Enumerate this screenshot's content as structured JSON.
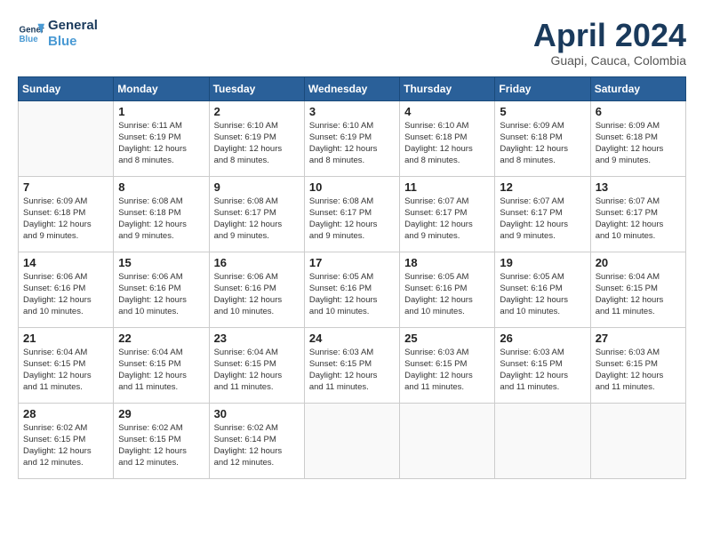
{
  "header": {
    "logo_line1": "General",
    "logo_line2": "Blue",
    "month_year": "April 2024",
    "location": "Guapi, Cauca, Colombia"
  },
  "weekdays": [
    "Sunday",
    "Monday",
    "Tuesday",
    "Wednesday",
    "Thursday",
    "Friday",
    "Saturday"
  ],
  "weeks": [
    [
      {
        "day": null,
        "info": null
      },
      {
        "day": "1",
        "info": "Sunrise: 6:11 AM\nSunset: 6:19 PM\nDaylight: 12 hours\nand 8 minutes."
      },
      {
        "day": "2",
        "info": "Sunrise: 6:10 AM\nSunset: 6:19 PM\nDaylight: 12 hours\nand 8 minutes."
      },
      {
        "day": "3",
        "info": "Sunrise: 6:10 AM\nSunset: 6:19 PM\nDaylight: 12 hours\nand 8 minutes."
      },
      {
        "day": "4",
        "info": "Sunrise: 6:10 AM\nSunset: 6:18 PM\nDaylight: 12 hours\nand 8 minutes."
      },
      {
        "day": "5",
        "info": "Sunrise: 6:09 AM\nSunset: 6:18 PM\nDaylight: 12 hours\nand 8 minutes."
      },
      {
        "day": "6",
        "info": "Sunrise: 6:09 AM\nSunset: 6:18 PM\nDaylight: 12 hours\nand 9 minutes."
      }
    ],
    [
      {
        "day": "7",
        "info": "Sunrise: 6:09 AM\nSunset: 6:18 PM\nDaylight: 12 hours\nand 9 minutes."
      },
      {
        "day": "8",
        "info": "Sunrise: 6:08 AM\nSunset: 6:18 PM\nDaylight: 12 hours\nand 9 minutes."
      },
      {
        "day": "9",
        "info": "Sunrise: 6:08 AM\nSunset: 6:17 PM\nDaylight: 12 hours\nand 9 minutes."
      },
      {
        "day": "10",
        "info": "Sunrise: 6:08 AM\nSunset: 6:17 PM\nDaylight: 12 hours\nand 9 minutes."
      },
      {
        "day": "11",
        "info": "Sunrise: 6:07 AM\nSunset: 6:17 PM\nDaylight: 12 hours\nand 9 minutes."
      },
      {
        "day": "12",
        "info": "Sunrise: 6:07 AM\nSunset: 6:17 PM\nDaylight: 12 hours\nand 9 minutes."
      },
      {
        "day": "13",
        "info": "Sunrise: 6:07 AM\nSunset: 6:17 PM\nDaylight: 12 hours\nand 10 minutes."
      }
    ],
    [
      {
        "day": "14",
        "info": "Sunrise: 6:06 AM\nSunset: 6:16 PM\nDaylight: 12 hours\nand 10 minutes."
      },
      {
        "day": "15",
        "info": "Sunrise: 6:06 AM\nSunset: 6:16 PM\nDaylight: 12 hours\nand 10 minutes."
      },
      {
        "day": "16",
        "info": "Sunrise: 6:06 AM\nSunset: 6:16 PM\nDaylight: 12 hours\nand 10 minutes."
      },
      {
        "day": "17",
        "info": "Sunrise: 6:05 AM\nSunset: 6:16 PM\nDaylight: 12 hours\nand 10 minutes."
      },
      {
        "day": "18",
        "info": "Sunrise: 6:05 AM\nSunset: 6:16 PM\nDaylight: 12 hours\nand 10 minutes."
      },
      {
        "day": "19",
        "info": "Sunrise: 6:05 AM\nSunset: 6:16 PM\nDaylight: 12 hours\nand 10 minutes."
      },
      {
        "day": "20",
        "info": "Sunrise: 6:04 AM\nSunset: 6:15 PM\nDaylight: 12 hours\nand 11 minutes."
      }
    ],
    [
      {
        "day": "21",
        "info": "Sunrise: 6:04 AM\nSunset: 6:15 PM\nDaylight: 12 hours\nand 11 minutes."
      },
      {
        "day": "22",
        "info": "Sunrise: 6:04 AM\nSunset: 6:15 PM\nDaylight: 12 hours\nand 11 minutes."
      },
      {
        "day": "23",
        "info": "Sunrise: 6:04 AM\nSunset: 6:15 PM\nDaylight: 12 hours\nand 11 minutes."
      },
      {
        "day": "24",
        "info": "Sunrise: 6:03 AM\nSunset: 6:15 PM\nDaylight: 12 hours\nand 11 minutes."
      },
      {
        "day": "25",
        "info": "Sunrise: 6:03 AM\nSunset: 6:15 PM\nDaylight: 12 hours\nand 11 minutes."
      },
      {
        "day": "26",
        "info": "Sunrise: 6:03 AM\nSunset: 6:15 PM\nDaylight: 12 hours\nand 11 minutes."
      },
      {
        "day": "27",
        "info": "Sunrise: 6:03 AM\nSunset: 6:15 PM\nDaylight: 12 hours\nand 11 minutes."
      }
    ],
    [
      {
        "day": "28",
        "info": "Sunrise: 6:02 AM\nSunset: 6:15 PM\nDaylight: 12 hours\nand 12 minutes."
      },
      {
        "day": "29",
        "info": "Sunrise: 6:02 AM\nSunset: 6:15 PM\nDaylight: 12 hours\nand 12 minutes."
      },
      {
        "day": "30",
        "info": "Sunrise: 6:02 AM\nSunset: 6:14 PM\nDaylight: 12 hours\nand 12 minutes."
      },
      {
        "day": null,
        "info": null
      },
      {
        "day": null,
        "info": null
      },
      {
        "day": null,
        "info": null
      },
      {
        "day": null,
        "info": null
      }
    ]
  ]
}
